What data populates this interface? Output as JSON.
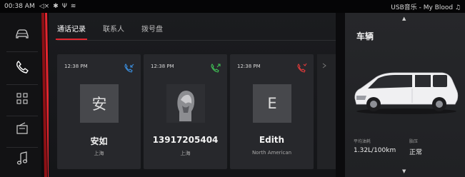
{
  "status_bar": {
    "time": "00:38 AM",
    "icons": [
      "volume-icon",
      "bluetooth-icon",
      "usb-icon",
      "wifi-icon"
    ],
    "now_playing": "USB音乐 - My Blood ♫"
  },
  "rail": {
    "items": [
      "car-icon",
      "phone-icon",
      "apps-grid-icon",
      "radio-icon",
      "music-note-icon"
    ],
    "active": "phone-icon"
  },
  "tabs": [
    {
      "label": "通话记录",
      "active": true
    },
    {
      "label": "联系人",
      "active": false
    },
    {
      "label": "拨号盘",
      "active": false
    }
  ],
  "calls": [
    {
      "time": "12:38 PM",
      "type": "incoming-call",
      "type_color": "#3b8fe0",
      "avatar_letter": "安",
      "name": "安如",
      "location": "上海"
    },
    {
      "time": "12:38 PM",
      "type": "outgoing-call",
      "type_color": "#3fbf55",
      "avatar_letter": "",
      "name": "13917205404",
      "location": "上海"
    },
    {
      "time": "12:38 PM",
      "type": "missed-call",
      "type_color": "#e23a3a",
      "avatar_letter": "E",
      "name": "Edith",
      "location": "North American"
    }
  ],
  "vehicle": {
    "title": "车辆",
    "fuel": {
      "label": "平均油耗",
      "value": "1.32L/100km"
    },
    "tire": {
      "label": "胎压",
      "value": "正常"
    }
  },
  "colors": {
    "accent_red": "#e2262f",
    "card_bg": "#27282c"
  }
}
